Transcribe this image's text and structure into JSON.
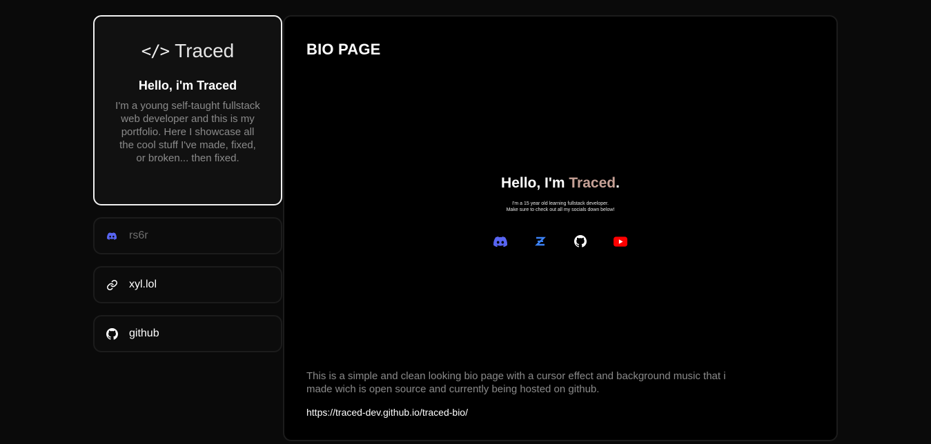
{
  "profile": {
    "logo_mark": "</>",
    "logo_text": "Traced",
    "hello": "Hello, i'm Traced",
    "description": "I'm a young self-taught fullstack web developer and this is my portfolio. Here I showcase all the cool stuff I've made, fixed, or broken... then fixed."
  },
  "links": [
    {
      "label": "rs6r",
      "icon": "discord-icon",
      "color": "#6e6e6e",
      "icon_color": "#5865f2"
    },
    {
      "label": "xyl.lol",
      "icon": "link-icon",
      "color": "#ffffff",
      "icon_color": "#ffffff"
    },
    {
      "label": "github",
      "icon": "github-icon",
      "color": "#ffffff",
      "icon_color": "#ffffff"
    }
  ],
  "main": {
    "title": "BIO PAGE",
    "preview": {
      "hello_prefix": "Hello, I'm ",
      "hello_name": "Traced",
      "hello_suffix": ".",
      "subtitle_line1": "I'm a 15 year old learning fullstack developer.",
      "subtitle_line2": "Make sure to check out all my socials down below!",
      "socials": [
        "discord-icon",
        "guns-lol-icon",
        "github-icon",
        "youtube-icon"
      ]
    },
    "description": "This is a simple and clean looking bio page with a cursor effect and background music that i made wich is open source and currently being hosted on github.",
    "url": "https://traced-dev.github.io/traced-bio/"
  },
  "colors": {
    "background": "#0a0a0a",
    "accent": "#c6a196",
    "discord": "#5865f2",
    "youtube": "#ff0000"
  }
}
